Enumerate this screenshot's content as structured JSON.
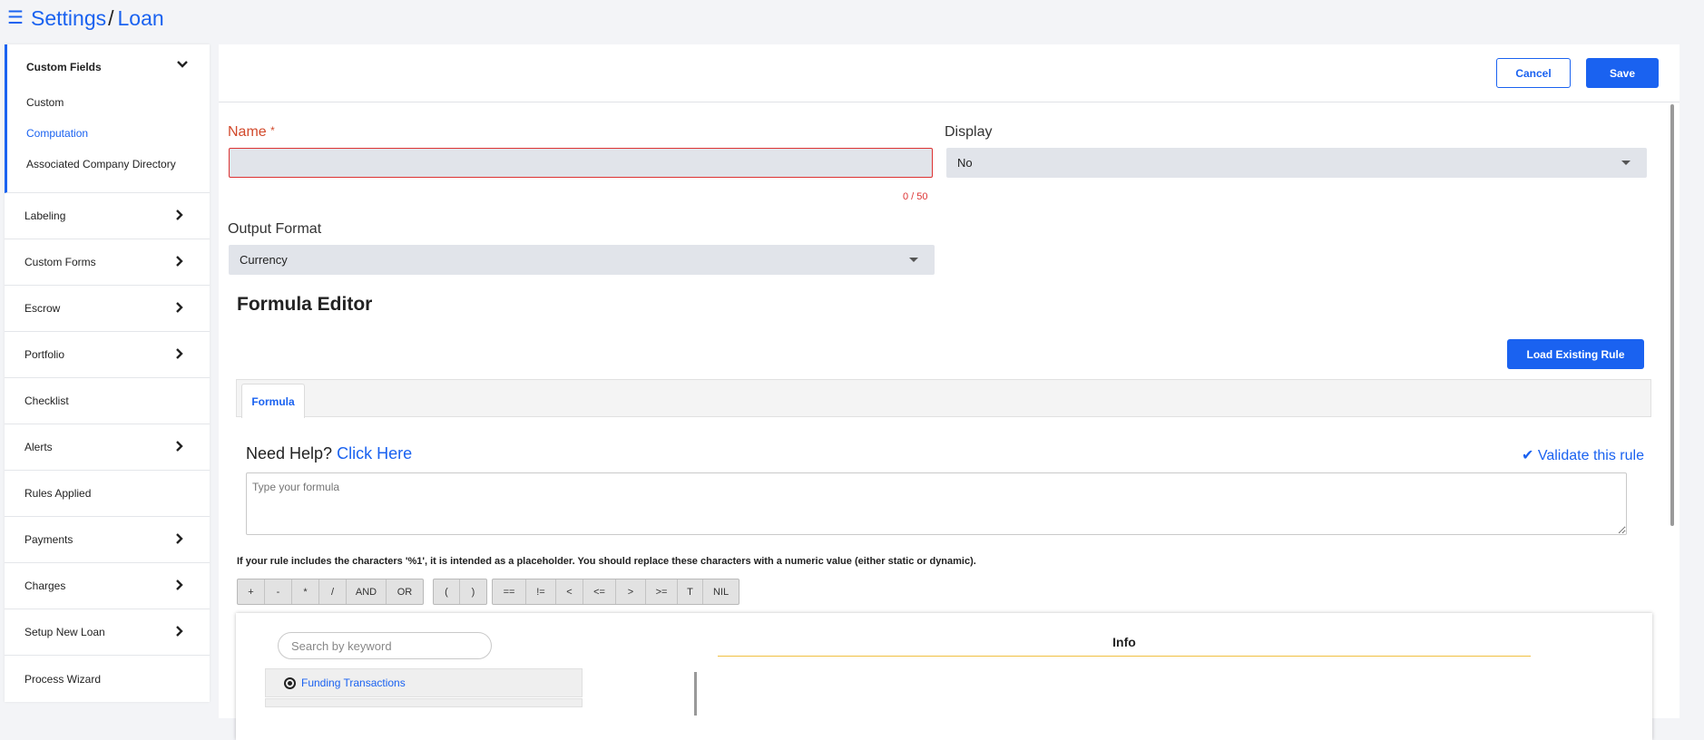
{
  "breadcrumb": {
    "menu_icon": "hamburger-icon",
    "root": "Settings",
    "separator": "/",
    "current": "Loan"
  },
  "sidebar": {
    "custom_fields": {
      "label": "Custom Fields",
      "items": [
        {
          "label": "Custom",
          "active": false
        },
        {
          "label": "Computation",
          "active": true
        },
        {
          "label": "Associated Company Directory",
          "active": false
        }
      ]
    },
    "items": [
      {
        "label": "Labeling",
        "expandable": true
      },
      {
        "label": "Custom Forms",
        "expandable": true
      },
      {
        "label": "Escrow",
        "expandable": true
      },
      {
        "label": "Portfolio",
        "expandable": true
      },
      {
        "label": "Checklist",
        "expandable": false
      },
      {
        "label": "Alerts",
        "expandable": true
      },
      {
        "label": "Rules Applied",
        "expandable": false
      },
      {
        "label": "Payments",
        "expandable": true
      },
      {
        "label": "Charges",
        "expandable": true
      },
      {
        "label": "Setup New Loan",
        "expandable": true
      },
      {
        "label": "Process Wizard",
        "expandable": false
      }
    ]
  },
  "header": {
    "cancel_label": "Cancel",
    "save_label": "Save"
  },
  "form": {
    "name_label": "Name",
    "required_mark": "*",
    "name_value": "",
    "name_counter": "0 / 50",
    "display_label": "Display",
    "display_value": "No",
    "output_format_label": "Output Format",
    "output_format_value": "Currency"
  },
  "formula_editor": {
    "title": "Formula Editor",
    "load_button": "Load Existing Rule",
    "tab_label": "Formula",
    "help_text": "Need Help?",
    "help_link": "Click Here",
    "validate_label": "Validate this rule",
    "formula_placeholder": "Type your formula",
    "note": "If your rule includes the characters '%1', it is intended as a placeholder. You should replace these characters with a numeric value (either static or dynamic).",
    "operator_groups": [
      [
        "+",
        "-",
        "*",
        "/",
        "AND",
        "OR"
      ],
      [
        "(",
        ")"
      ],
      [
        "==",
        "!=",
        "<",
        "<=",
        ">",
        ">=",
        "T",
        "NIL"
      ]
    ]
  },
  "rules_panel": {
    "search_placeholder": "Search by keyword",
    "info_title": "Info",
    "categories": [
      {
        "label": "Funding Transactions",
        "selected": true
      }
    ]
  },
  "colors": {
    "accent": "#1a62f0",
    "error": "#d33333",
    "field_bg": "#e1e4ea"
  }
}
